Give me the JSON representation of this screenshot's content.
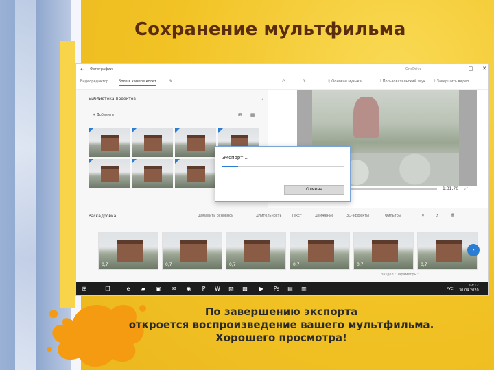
{
  "slide": {
    "title": "Сохранение мультфильма",
    "caption": [
      "По завершению экспорта",
      "откроется воспроизведение вашего мультфильма.",
      "Хорошего просмотра!"
    ]
  },
  "window": {
    "app_name": "Фотографии",
    "cloud_label": "OneDrive",
    "breadcrumb_prev": "Видеоредактор",
    "project_name": "Боле в камере колет",
    "toolbar": {
      "music": "Фоновая музыка",
      "custom_audio": "Пользовательский звук",
      "finish": "Завершить видео"
    },
    "library": {
      "title": "Библиотека проектов",
      "add": "Добавить"
    },
    "player": {
      "time": "1:31,70",
      "progress_fraction": 0.0
    },
    "storyboard": {
      "title": "Раскадровка",
      "tools": [
        "Добавить основной",
        "Длительность",
        "Текст",
        "Движение",
        "3D-эффекты",
        "Фильтры"
      ],
      "clips": [
        "0,7",
        "0,7",
        "0,7",
        "0,7",
        "0,7",
        "0,7"
      ],
      "hint": "раздел \"Параметры\"."
    },
    "export_dialog": {
      "title": "Экспорт...",
      "progress_fraction": 0.13,
      "cancel": "Отмена"
    },
    "taskbar": {
      "lang": "РУС",
      "time": "12:12",
      "date": "30.04.2020"
    }
  }
}
